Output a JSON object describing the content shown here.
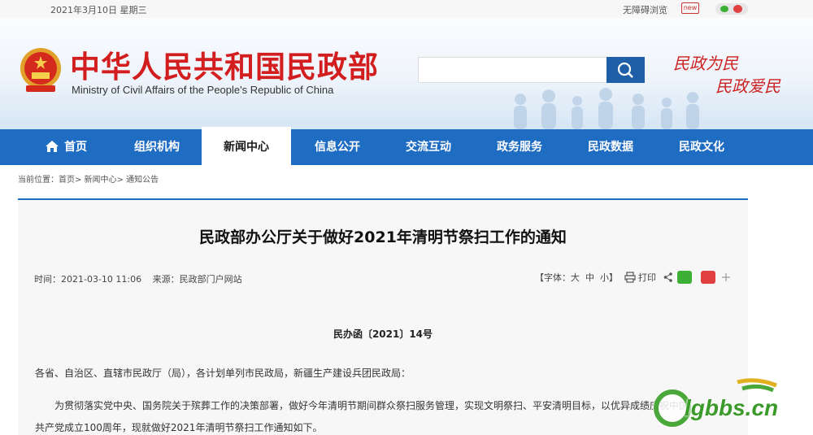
{
  "topbar": {
    "date": "2021年3月10日 星期三",
    "accessibility": "无障碍浏览",
    "new_icon": "new"
  },
  "header": {
    "title": "中华人民共和国民政部",
    "subtitle": "Ministry of Civil Affairs of the People's Republic of China",
    "search_placeholder": "",
    "slogan_line1": "民政为民",
    "slogan_line2": "民政爱民",
    "brand_red": "#d21e1e"
  },
  "nav": {
    "color": "#1f6cc3",
    "items": [
      {
        "label": "首页",
        "icon": "home-icon"
      },
      {
        "label": "组织机构"
      },
      {
        "label": "新闻中心",
        "active": true
      },
      {
        "label": "信息公开"
      },
      {
        "label": "交流互动"
      },
      {
        "label": "政务服务"
      },
      {
        "label": "民政数据"
      },
      {
        "label": "民政文化"
      }
    ]
  },
  "breadcrumb": "当前位置：首页> 新闻中心> 通知公告",
  "article": {
    "title": "民政部办公厅关于做好2021年清明节祭扫工作的通知",
    "time_label": "时间：",
    "time": "2021-03-10 11:06",
    "source_label": "来源：",
    "source": "民政部门户网站",
    "font_size_label": "【字体：",
    "font_large": "大",
    "font_medium": "中",
    "font_small": "小】",
    "print_label": "打印",
    "doc_number": "民办函〔2021〕14号",
    "salutation": "各省、自治区、直辖市民政厅（局），各计划单列市民政局，新疆生产建设兵团民政局：",
    "para1_line1": "为贯彻落实党中央、国务院关于殡葬工作的决策部署，做好今年清明节期间群众祭扫服务管理，实现文明祭扫、平安清明目标，以优异成绩庆祝中国",
    "para1_line2": "共产党成立100周年，现就做好2021年清明节祭扫工作通知如下。"
  },
  "watermark": {
    "text": "lgbbs.cn"
  }
}
